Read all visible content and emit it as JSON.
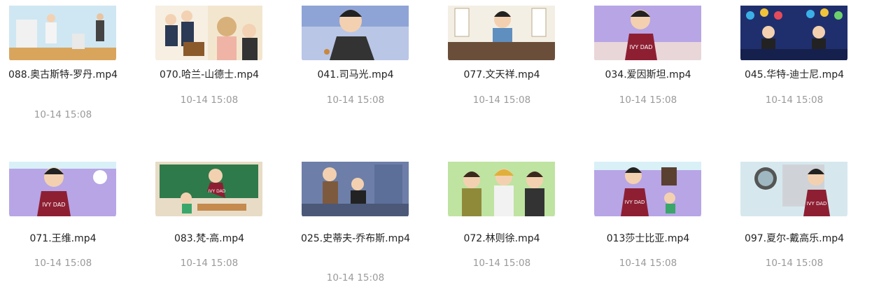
{
  "files": [
    {
      "name": "088.奥古斯特-罗丹.mp4",
      "time": "10-14 15:08",
      "thumb_icon": "video-thumbnail-icon"
    },
    {
      "name": "070.哈兰-山德士.mp4",
      "time": "10-14 15:08",
      "thumb_icon": "video-thumbnail-icon"
    },
    {
      "name": "041.司马光.mp4",
      "time": "10-14 15:08",
      "thumb_icon": "video-thumbnail-icon"
    },
    {
      "name": "077.文天祥.mp4",
      "time": "10-14 15:08",
      "thumb_icon": "video-thumbnail-icon"
    },
    {
      "name": "034.爱因斯坦.mp4",
      "time": "10-14 15:08",
      "thumb_icon": "video-thumbnail-icon"
    },
    {
      "name": "045.华特-迪士尼.mp4",
      "time": "10-14 15:08",
      "thumb_icon": "video-thumbnail-icon"
    },
    {
      "name": "071.王维.mp4",
      "time": "10-14 15:08",
      "thumb_icon": "video-thumbnail-icon"
    },
    {
      "name": "083.梵-高.mp4",
      "time": "10-14 15:08",
      "thumb_icon": "video-thumbnail-icon"
    },
    {
      "name": "025.史蒂夫-乔布斯.mp4",
      "time": "10-14 15:08",
      "thumb_icon": "video-thumbnail-icon"
    },
    {
      "name": "072.林则徐.mp4",
      "time": "10-14 15:08",
      "thumb_icon": "video-thumbnail-icon"
    },
    {
      "name": "013莎士比亚.mp4",
      "time": "10-14 15:08",
      "thumb_icon": "video-thumbnail-icon"
    },
    {
      "name": "097.夏尔-戴高乐.mp4",
      "time": "10-14 15:08",
      "thumb_icon": "video-thumbnail-icon"
    }
  ],
  "shirt_text": "IVY DAD"
}
